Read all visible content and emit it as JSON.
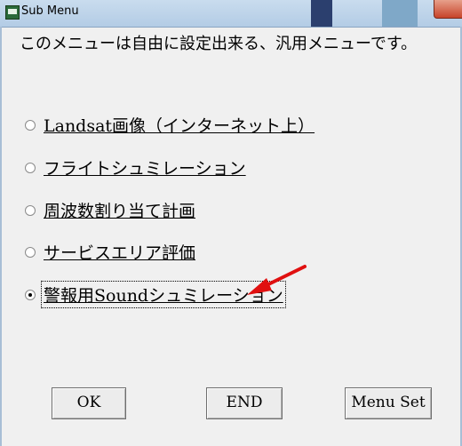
{
  "window": {
    "title": "Sub Menu"
  },
  "description": "このメニューは自由に設定出来る、汎用メニューです。",
  "options": [
    {
      "label": "Landsat画像（インターネット上）",
      "selected": false
    },
    {
      "label": "フライトシュミレーション",
      "selected": false
    },
    {
      "label": "周波数割り当て計画",
      "selected": false
    },
    {
      "label": "サービスエリア評価",
      "selected": false
    },
    {
      "label": "警報用Soundシュミレーション",
      "selected": true
    }
  ],
  "buttons": {
    "ok": "OK",
    "end": "END",
    "menu_set": "Menu Set"
  },
  "colors": {
    "window_bg": "#f0f0f0",
    "annotation_arrow": "#e01010"
  }
}
